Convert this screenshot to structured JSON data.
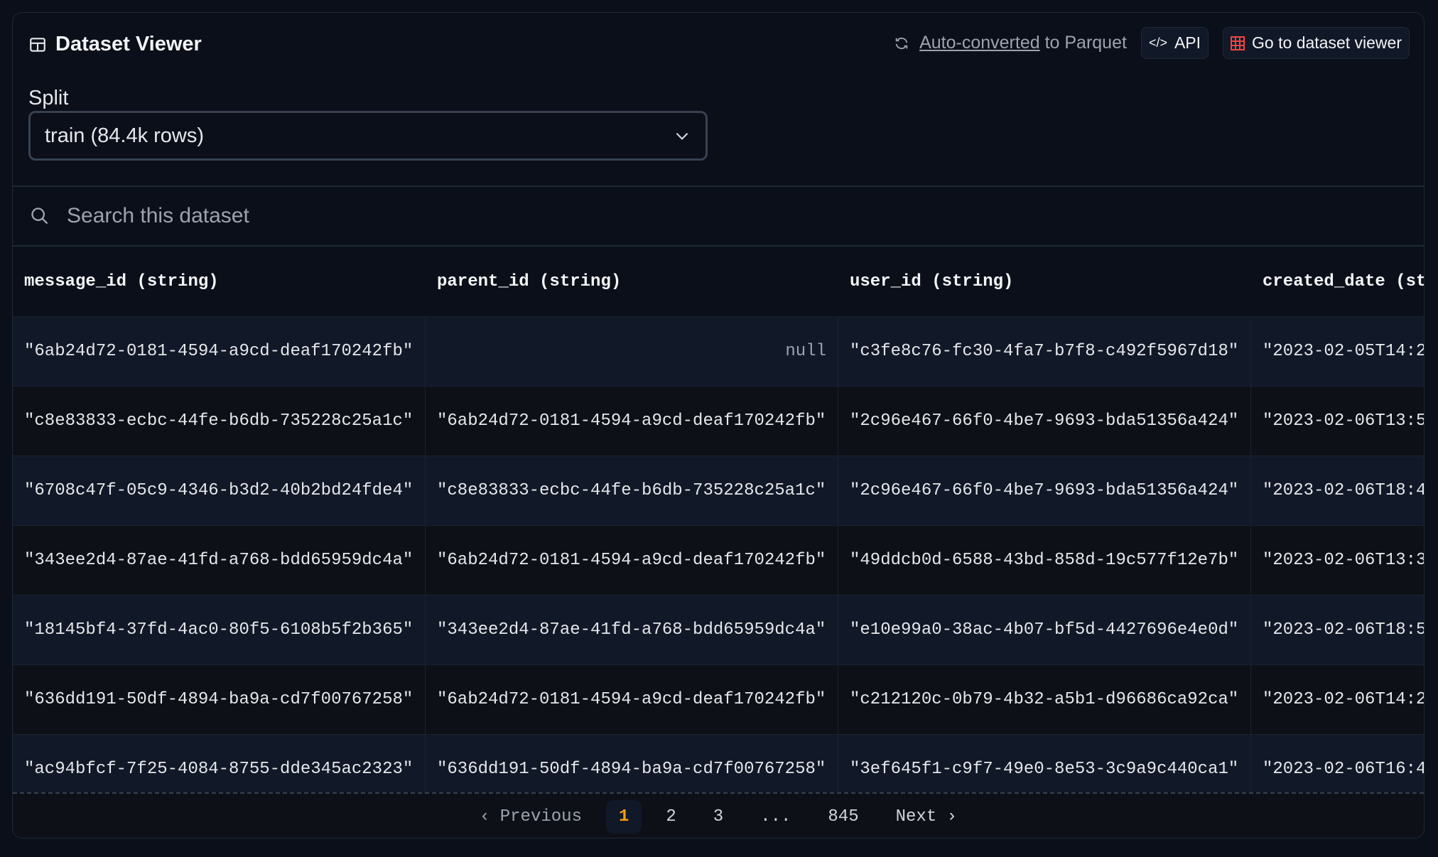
{
  "header": {
    "title": "Dataset Viewer",
    "converted_link": "Auto-converted",
    "converted_suffix": " to Parquet",
    "api_label": "API",
    "go_label": "Go to dataset viewer"
  },
  "split": {
    "label": "Split",
    "value": "train (84.4k rows)"
  },
  "search": {
    "placeholder": "Search this dataset"
  },
  "table": {
    "columns": [
      "message_id (string)",
      "parent_id (string)",
      "user_id (string)",
      "created_date (st"
    ],
    "rows": [
      [
        "\"6ab24d72-0181-4594-a9cd-deaf170242fb\"",
        "null",
        "\"c3fe8c76-fc30-4fa7-b7f8-c492f5967d18\"",
        "\"2023-02-05T14:2"
      ],
      [
        "\"c8e83833-ecbc-44fe-b6db-735228c25a1c\"",
        "\"6ab24d72-0181-4594-a9cd-deaf170242fb\"",
        "\"2c96e467-66f0-4be7-9693-bda51356a424\"",
        "\"2023-02-06T13:5"
      ],
      [
        "\"6708c47f-05c9-4346-b3d2-40b2bd24fde4\"",
        "\"c8e83833-ecbc-44fe-b6db-735228c25a1c\"",
        "\"2c96e467-66f0-4be7-9693-bda51356a424\"",
        "\"2023-02-06T18:4"
      ],
      [
        "\"343ee2d4-87ae-41fd-a768-bdd65959dc4a\"",
        "\"6ab24d72-0181-4594-a9cd-deaf170242fb\"",
        "\"49ddcb0d-6588-43bd-858d-19c577f12e7b\"",
        "\"2023-02-06T13:3"
      ],
      [
        "\"18145bf4-37fd-4ac0-80f5-6108b5f2b365\"",
        "\"343ee2d4-87ae-41fd-a768-bdd65959dc4a\"",
        "\"e10e99a0-38ac-4b07-bf5d-4427696e4e0d\"",
        "\"2023-02-06T18:5"
      ],
      [
        "\"636dd191-50df-4894-ba9a-cd7f00767258\"",
        "\"6ab24d72-0181-4594-a9cd-deaf170242fb\"",
        "\"c212120c-0b79-4b32-a5b1-d96686ca92ca\"",
        "\"2023-02-06T14:2"
      ],
      [
        "\"ac94bfcf-7f25-4084-8755-dde345ac2323\"",
        "\"636dd191-50df-4894-ba9a-cd7f00767258\"",
        "\"3ef645f1-c9f7-49e0-8e53-3c9a9c440ca1\"",
        "\"2023-02-06T16:4"
      ]
    ]
  },
  "pagination": {
    "previous": "Previous",
    "pages": [
      "1",
      "2",
      "3",
      "...",
      "845"
    ],
    "next": "Next",
    "current": "1"
  },
  "colors": {
    "accent": "#f59e0b",
    "grid_icon": "#ef4444"
  }
}
